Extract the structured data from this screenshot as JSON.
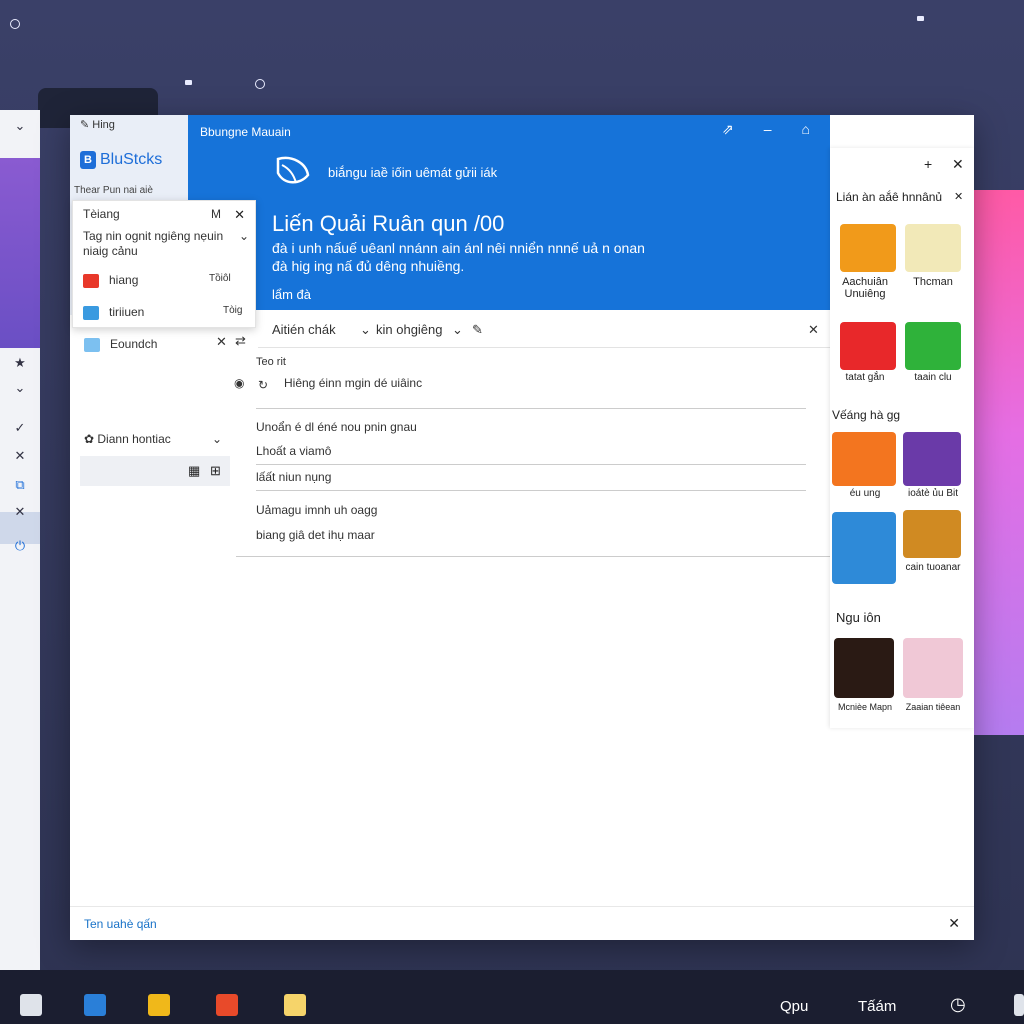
{
  "desktop": {
    "pink_color": "#ff5aa6"
  },
  "window": {
    "top_label": "Hing",
    "brand": "BluStcks",
    "brand_sub": "Thear Pun nai aiè",
    "blue_title": "Bbungne Mauain",
    "subtitle": "biắngu iaề iốin uêmát gửii iák",
    "heading": "Liến Quải Ruân qun /00",
    "description": "đà i unh nấuế uêanl nnánn ain ánl nêi nniển nnnế uả n onan đà hig ing nấ đủ dêng nhuiềng.",
    "more_link": "lẩm đà",
    "toolbar": {
      "item1": "Aitién chák",
      "item2": "kin ohgiêng"
    },
    "dropdown": {
      "header": "Tèiang",
      "header_key": "M",
      "line": "Tag nin ognit ngiêng nẹuin niaig cảnu",
      "items": [
        {
          "label": "hiang",
          "meta": "Tồiôl"
        },
        {
          "label": "tiriiuen",
          "meta": "Tòig"
        }
      ],
      "extra": "Eoundch"
    },
    "nav_item": "Diann hontiac",
    "content": {
      "section_label": "Teo rit",
      "line1": "Hiêng éinn mgin dé uiâinc",
      "line2": "Unoẩn é dl éné nou pnin gnau",
      "line3": "Lhoất a viamô",
      "line4": "lấất niun nụng",
      "line5": "Uảmagu imnh uh oagg",
      "line6": "biang giâ det ihụ maar"
    },
    "footer": "Ten uahè qấn"
  },
  "sidebar": {
    "header": "Lián àn aắê hnnânủ",
    "group1_label": "Vếáng hà gg",
    "group2_label": "Ngu iôn",
    "tiles": [
      {
        "label": "Aachuiân Unuiêng",
        "color": "#f19a1a",
        "icon": "photo-app-icon"
      },
      {
        "label": "Thcman",
        "color": "#f2e9b8",
        "icon": "bird-app-icon"
      },
      {
        "label": "tatat gắn",
        "color": "#e8282a",
        "icon": "red-app-icon"
      },
      {
        "label": "taain clu",
        "color": "#2fb23a",
        "icon": "green-app-icon"
      },
      {
        "label": "éu ung",
        "color": "#f3751f",
        "icon": "fruit-app-icon"
      },
      {
        "label": "ioátè ủu Bit",
        "color": "#6a3aa8",
        "icon": "game-app-icon"
      },
      {
        "label": "",
        "color": "#2e8ad8",
        "icon": "shark-app-icon"
      },
      {
        "label": "cain tuoanar",
        "color": "#d08a22",
        "icon": "pet-app-icon"
      },
      {
        "label": "Mcnièe Mapn",
        "color": "#2a1a14",
        "icon": "puzzle-app-icon"
      },
      {
        "label": "Zaaian tiêean",
        "color": "#f0c8d6",
        "icon": "character-app-icon"
      }
    ]
  },
  "taskbar": {
    "text1": "Qpu",
    "text2": "Tấám"
  },
  "colors": {
    "accent": "#1673d9",
    "link": "#1a73c8"
  }
}
